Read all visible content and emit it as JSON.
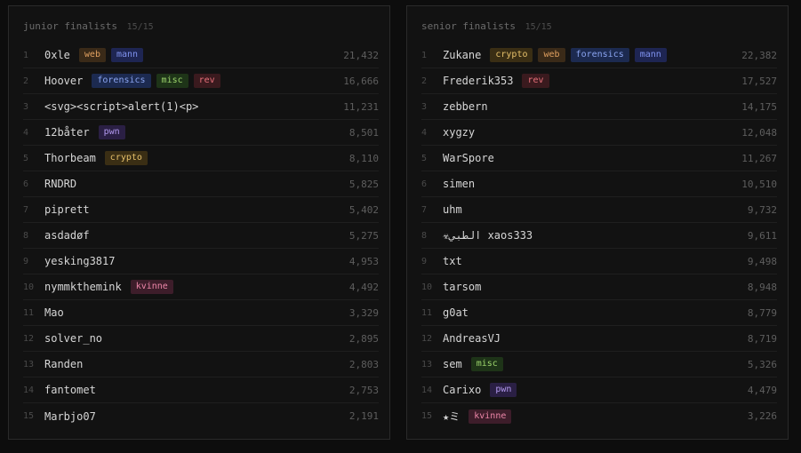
{
  "tag_styles": {
    "web": {
      "bg": "#3a2a18",
      "fg": "#e0a060"
    },
    "mann": {
      "bg": "#1e2552",
      "fg": "#7f92ef"
    },
    "forensics": {
      "bg": "#1c2a50",
      "fg": "#8aa4f0"
    },
    "misc": {
      "bg": "#1e3418",
      "fg": "#9cd46c"
    },
    "rev": {
      "bg": "#3a1a1e",
      "fg": "#e8707a"
    },
    "pwn": {
      "bg": "#2a1f44",
      "fg": "#b39af0"
    },
    "crypto": {
      "bg": "#3a2e14",
      "fg": "#e6c06a"
    },
    "kvinne": {
      "bg": "#3d1d2a",
      "fg": "#ec86a8"
    }
  },
  "panels": [
    {
      "title": "junior finalists",
      "count": "15/15",
      "rows": [
        {
          "rank": "1",
          "name": "0xle",
          "tags": [
            "web",
            "mann"
          ],
          "score": "21,432"
        },
        {
          "rank": "2",
          "name": "Hoover",
          "tags": [
            "forensics",
            "misc",
            "rev"
          ],
          "score": "16,666"
        },
        {
          "rank": "3",
          "name": "<svg><script>alert(1)<p>",
          "tags": [],
          "score": "11,231"
        },
        {
          "rank": "4",
          "name": "12båter",
          "tags": [
            "pwn"
          ],
          "score": "8,501"
        },
        {
          "rank": "5",
          "name": "Thorbeam",
          "tags": [
            "crypto"
          ],
          "score": "8,110"
        },
        {
          "rank": "6",
          "name": "RNDRD",
          "tags": [],
          "score": "5,825"
        },
        {
          "rank": "7",
          "name": "piprett",
          "tags": [],
          "score": "5,402"
        },
        {
          "rank": "8",
          "name": "asdadøf",
          "tags": [],
          "score": "5,275"
        },
        {
          "rank": "9",
          "name": "yesking3817",
          "tags": [],
          "score": "4,953"
        },
        {
          "rank": "10",
          "name": "nymmkthemink",
          "tags": [
            "kvinne"
          ],
          "score": "4,492"
        },
        {
          "rank": "11",
          "name": "Mao",
          "tags": [],
          "score": "3,329"
        },
        {
          "rank": "12",
          "name": "solver_no",
          "tags": [],
          "score": "2,895"
        },
        {
          "rank": "13",
          "name": "Randen",
          "tags": [],
          "score": "2,803"
        },
        {
          "rank": "14",
          "name": "fantomet",
          "tags": [],
          "score": "2,753"
        },
        {
          "rank": "15",
          "name": "Marbjo07",
          "tags": [],
          "score": "2,191"
        }
      ]
    },
    {
      "title": "senior finalists",
      "count": "15/15",
      "rows": [
        {
          "rank": "1",
          "name": "Zukane",
          "tags": [
            "crypto",
            "web",
            "forensics",
            "mann"
          ],
          "score": "22,382"
        },
        {
          "rank": "2",
          "name": "Frederik353",
          "tags": [
            "rev"
          ],
          "score": "17,527"
        },
        {
          "rank": "3",
          "name": "zebbern",
          "tags": [],
          "score": "14,175"
        },
        {
          "rank": "4",
          "name": "xygzy",
          "tags": [],
          "score": "12,048"
        },
        {
          "rank": "5",
          "name": "WarSpore",
          "tags": [],
          "score": "11,267"
        },
        {
          "rank": "6",
          "name": "simen",
          "tags": [],
          "score": "10,510"
        },
        {
          "rank": "7",
          "name": "uhm",
          "tags": [],
          "score": "9,732"
        },
        {
          "rank": "8",
          "name": "☣الطبي xaos333",
          "tags": [],
          "score": "9,611"
        },
        {
          "rank": "9",
          "name": "txt",
          "tags": [],
          "score": "9,498"
        },
        {
          "rank": "10",
          "name": "tarsom",
          "tags": [],
          "score": "8,948"
        },
        {
          "rank": "11",
          "name": "g0at",
          "tags": [],
          "score": "8,779"
        },
        {
          "rank": "12",
          "name": "AndreasVJ",
          "tags": [],
          "score": "8,719"
        },
        {
          "rank": "13",
          "name": "sem",
          "tags": [
            "misc"
          ],
          "score": "5,326"
        },
        {
          "rank": "14",
          "name": "Carixo",
          "tags": [
            "pwn"
          ],
          "score": "4,479"
        },
        {
          "rank": "15",
          "name": "★ミ",
          "tags": [
            "kvinne"
          ],
          "score": "3,226"
        }
      ]
    }
  ]
}
